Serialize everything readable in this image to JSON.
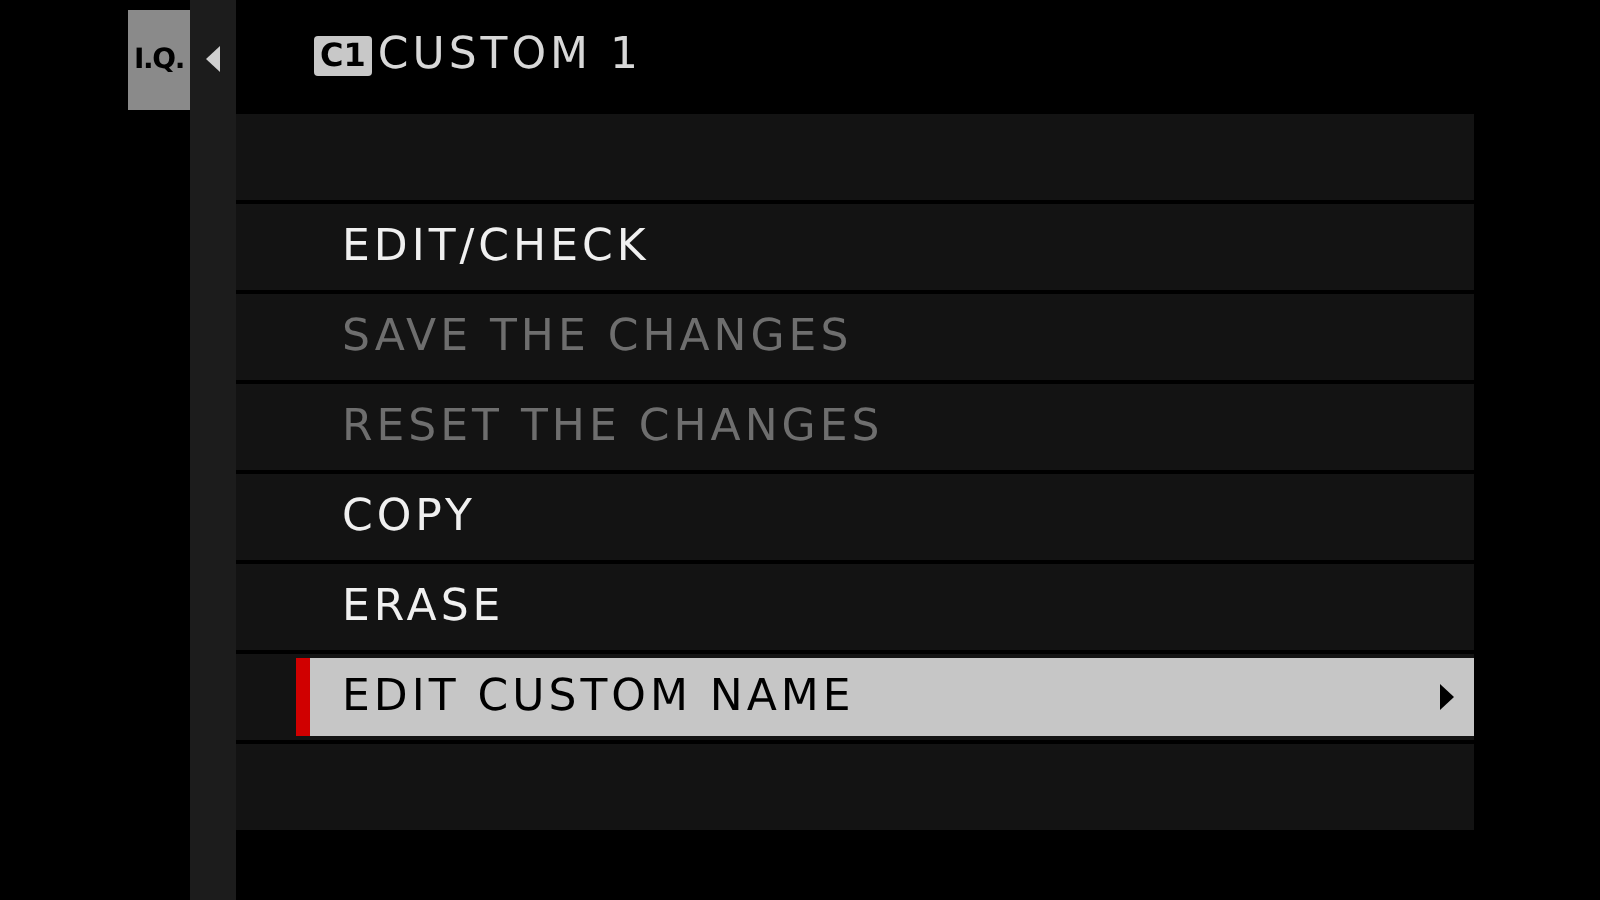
{
  "side_tab": {
    "label": "I.Q."
  },
  "header": {
    "badge": "C1",
    "title": "CUSTOM 1"
  },
  "menu": [
    {
      "label": "EDIT/CHECK",
      "disabled": false,
      "selected": false
    },
    {
      "label": "SAVE THE CHANGES",
      "disabled": true,
      "selected": false
    },
    {
      "label": "RESET THE CHANGES",
      "disabled": true,
      "selected": false
    },
    {
      "label": "COPY",
      "disabled": false,
      "selected": false
    },
    {
      "label": "ERASE",
      "disabled": false,
      "selected": false
    },
    {
      "label": "EDIT CUSTOM NAME",
      "disabled": false,
      "selected": true
    }
  ]
}
